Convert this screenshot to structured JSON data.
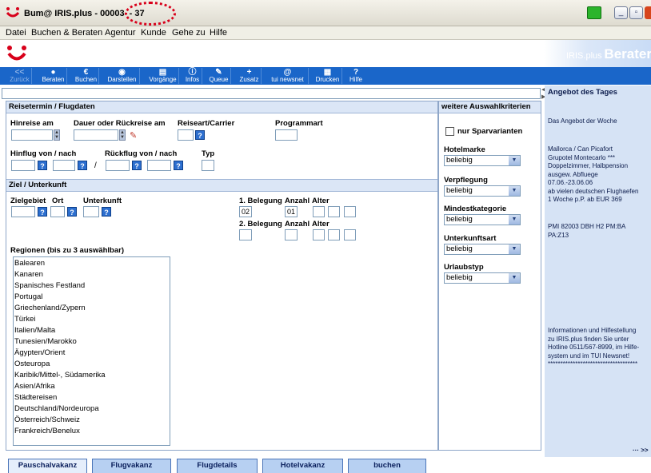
{
  "window": {
    "title": "Bum@ IRIS.plus - 00003",
    "title_suffix": "- 37"
  },
  "menu": {
    "items": [
      {
        "label": "Datei",
        "underline": "D"
      },
      {
        "label": "Buchen & Beraten",
        "underline": "B"
      },
      {
        "label": "Agentur",
        "underline": "A"
      },
      {
        "label": "Kunde",
        "underline": "K"
      },
      {
        "label": "Gehe zu",
        "underline": "G"
      },
      {
        "label": "Hilfe",
        "underline": "H"
      }
    ]
  },
  "brand": {
    "small": "IRIS.plus",
    "big": "Berater"
  },
  "toolbar": {
    "buttons": [
      {
        "label": "Zurück",
        "icon": "<<",
        "icon_name": "back-icon"
      },
      {
        "label": "Beraten",
        "icon": "●",
        "icon_name": "speech-bubble-icon"
      },
      {
        "label": "Buchen",
        "icon": "€",
        "icon_name": "euro-icon"
      },
      {
        "label": "Darstellen",
        "icon": "◉",
        "icon_name": "eye-icon"
      },
      {
        "label": "Vorgänge",
        "icon": "▤",
        "icon_name": "folder-icon"
      },
      {
        "label": "Infos",
        "icon": "ⓘ",
        "icon_name": "info-icon"
      },
      {
        "label": "Queue",
        "icon": "✎",
        "icon_name": "queue-icon"
      },
      {
        "label": "Zusatz",
        "icon": "+",
        "icon_name": "plus-icon"
      },
      {
        "label": "tui newsnet",
        "icon": "@",
        "icon_name": "at-icon"
      },
      {
        "label": "Drucken",
        "icon": "▦",
        "icon_name": "printer-icon"
      },
      {
        "label": "Hilfe",
        "icon": "?",
        "icon_name": "help-icon"
      }
    ]
  },
  "reisetermin": {
    "heading": "Reisetermin / Flugdaten",
    "hinreise_label": "Hinreise am",
    "dauer_label": "Dauer oder Rückreise am",
    "reiseart_label": "Reiseart/Carrier",
    "programmart_label": "Programmart",
    "hinflug_label": "Hinflug von / nach",
    "rueckflug_label": "Rückflug von / nach",
    "typ_label": "Typ",
    "slash": "/"
  },
  "ziel": {
    "heading": "Ziel / Unterkunft",
    "zielgebiet_label": "Zielgebiet",
    "ort_label": "Ort",
    "unterkunft_label": "Unterkunft",
    "belegung1_label": "1. Belegung",
    "belegung2_label": "2. Belegung",
    "anzahl_label": "Anzahl",
    "alter_label": "Alter",
    "belegung1_value": "02",
    "anzahl1_value": "01"
  },
  "regions": {
    "heading": "Regionen (bis zu 3 auswählbar)",
    "items": [
      "Balearen",
      "Kanaren",
      "Spanisches Festland",
      "Portugal",
      "Griechenland/Zypern",
      "Türkei",
      "Italien/Malta",
      "Tunesien/Marokko",
      "Ägypten/Orient",
      "Osteuropa",
      "Karibik/Mittel-, Südamerika",
      "Asien/Afrika",
      "Städtereisen",
      "Deutschland/Nordeuropa",
      "Österreich/Schweiz",
      "Frankreich/Benelux"
    ]
  },
  "kriterien": {
    "heading": "weitere Auswahlkriterien",
    "sparvarianten_label": "nur Sparvarianten",
    "hotelmarke_label": "Hotelmarke",
    "verpflegung_label": "Verpflegung",
    "mindestkategorie_label": "Mindestkategorie",
    "unterkunftsart_label": "Unterkunftsart",
    "urlaubstyp_label": "Urlaubstyp",
    "select_value": "beliebig"
  },
  "angebot": {
    "heading": "Angebot des Tages",
    "line1": "Das Angebot der Woche",
    "block": "Mallorca / Can Picafort\nGrupotel Montecarlo ***\nDoppelzimmer, Halbpension\nausgew. Abfluege\n07.06.-23.06.06\nab vielen deutschen Flughaefen\n1 Woche p.P. ab EUR 369",
    "code": "PMI 82003 DBH H2 PM:BA\nPA:Z13",
    "info": "Informationen und Hilfestellung\nzu IRIS.plus finden Sie unter\nHotline 0511/567-8999, im Hilfe-\nsystem und im TUI Newsnet!\n************************************",
    "more": "··· >>"
  },
  "tabs": [
    {
      "label": "Pauschalvakanz",
      "underline": "P"
    },
    {
      "label": "Flugvakanz",
      "underline": "F"
    },
    {
      "label": "Flugdetails",
      "underline": ""
    },
    {
      "label": "Hotelvakanz",
      "underline": "H"
    },
    {
      "label": "buchen",
      "underline": ""
    }
  ],
  "colors": {
    "toolbar": "#1a66c9",
    "panel_head": "#dbe6f6",
    "accent_red": "#d8001a"
  }
}
